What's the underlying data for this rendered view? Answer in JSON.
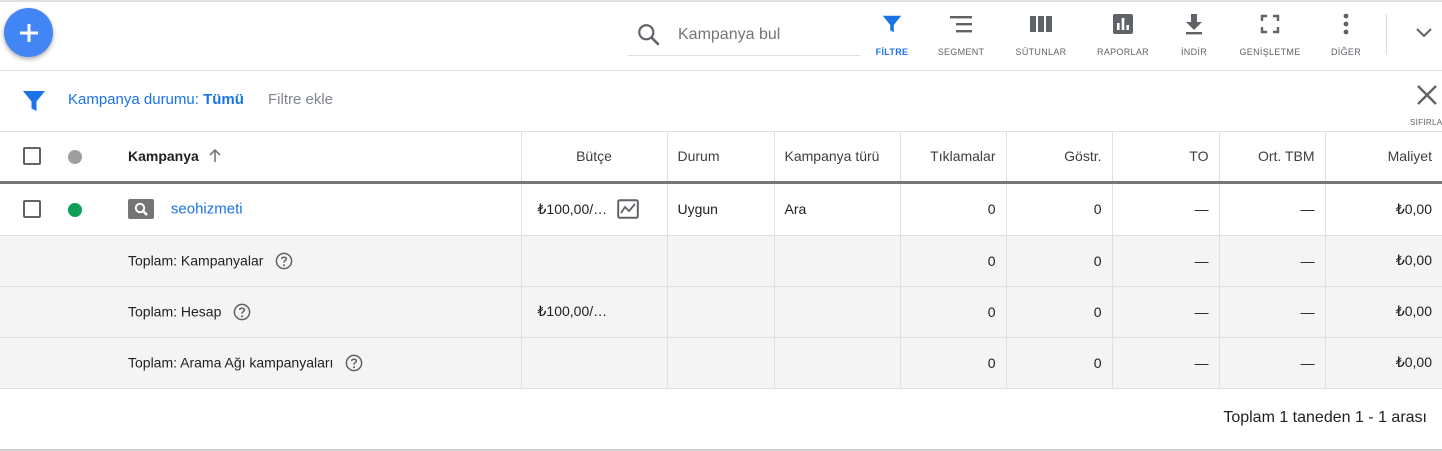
{
  "fab": {
    "icon": "plus-icon",
    "color": "#4285f4"
  },
  "search": {
    "placeholder": "Kampanya bul",
    "value": ""
  },
  "toolbar": {
    "items": [
      {
        "label": "FİLTRE",
        "icon": "filter-icon",
        "active": true
      },
      {
        "label": "SEGMENT",
        "icon": "segment-icon"
      },
      {
        "label": "SÜTUNLAR",
        "icon": "columns-icon"
      },
      {
        "label": "RAPORLAR",
        "icon": "reports-icon"
      },
      {
        "label": "İNDİR",
        "icon": "download-icon"
      },
      {
        "label": "GENİŞLETME",
        "icon": "expand-icon"
      },
      {
        "label": "DİĞER",
        "icon": "more-vert-icon"
      }
    ],
    "collapse_icon": "chevron-down-icon"
  },
  "filter_bar": {
    "chip_prefix": "Kampanya durumu:",
    "chip_value": "Tümü",
    "add_filter": "Filtre ekle",
    "reset_label": "SIFIRLA"
  },
  "table": {
    "headers": {
      "campaign": "Kampanya",
      "budget": "Bütçe",
      "status": "Durum",
      "type": "Kampanya türü",
      "clicks": "Tıklamalar",
      "impressions": "Göstr.",
      "ctr": "TO",
      "avg_cpc": "Ort. TBM",
      "cost": "Maliyet"
    },
    "rows": [
      {
        "name": "seohizmeti",
        "status_color": "#0f9d58",
        "budget": "₺100,00/…",
        "status": "Uygun",
        "type": "Ara",
        "clicks": "0",
        "impressions": "0",
        "ctr": "—",
        "avg_cpc": "—",
        "cost": "₺0,00"
      }
    ],
    "totals": [
      {
        "label": "Toplam: Kampanyalar",
        "budget": "",
        "clicks": "0",
        "impressions": "0",
        "ctr": "—",
        "avg_cpc": "—",
        "cost": "₺0,00"
      },
      {
        "label": "Toplam: Hesap",
        "budget": "₺100,00/…",
        "clicks": "0",
        "impressions": "0",
        "ctr": "—",
        "avg_cpc": "—",
        "cost": "₺0,00"
      },
      {
        "label": "Toplam: Arama Ağı kampanyaları",
        "budget": "",
        "clicks": "0",
        "impressions": "0",
        "ctr": "—",
        "avg_cpc": "—",
        "cost": "₺0,00"
      }
    ]
  },
  "pagination": {
    "text": "Toplam 1 taneden 1 - 1 arası"
  },
  "colors": {
    "accent": "#1a73e8",
    "header_dot": "#9e9e9e",
    "total_bg": "#f4f4f4"
  }
}
